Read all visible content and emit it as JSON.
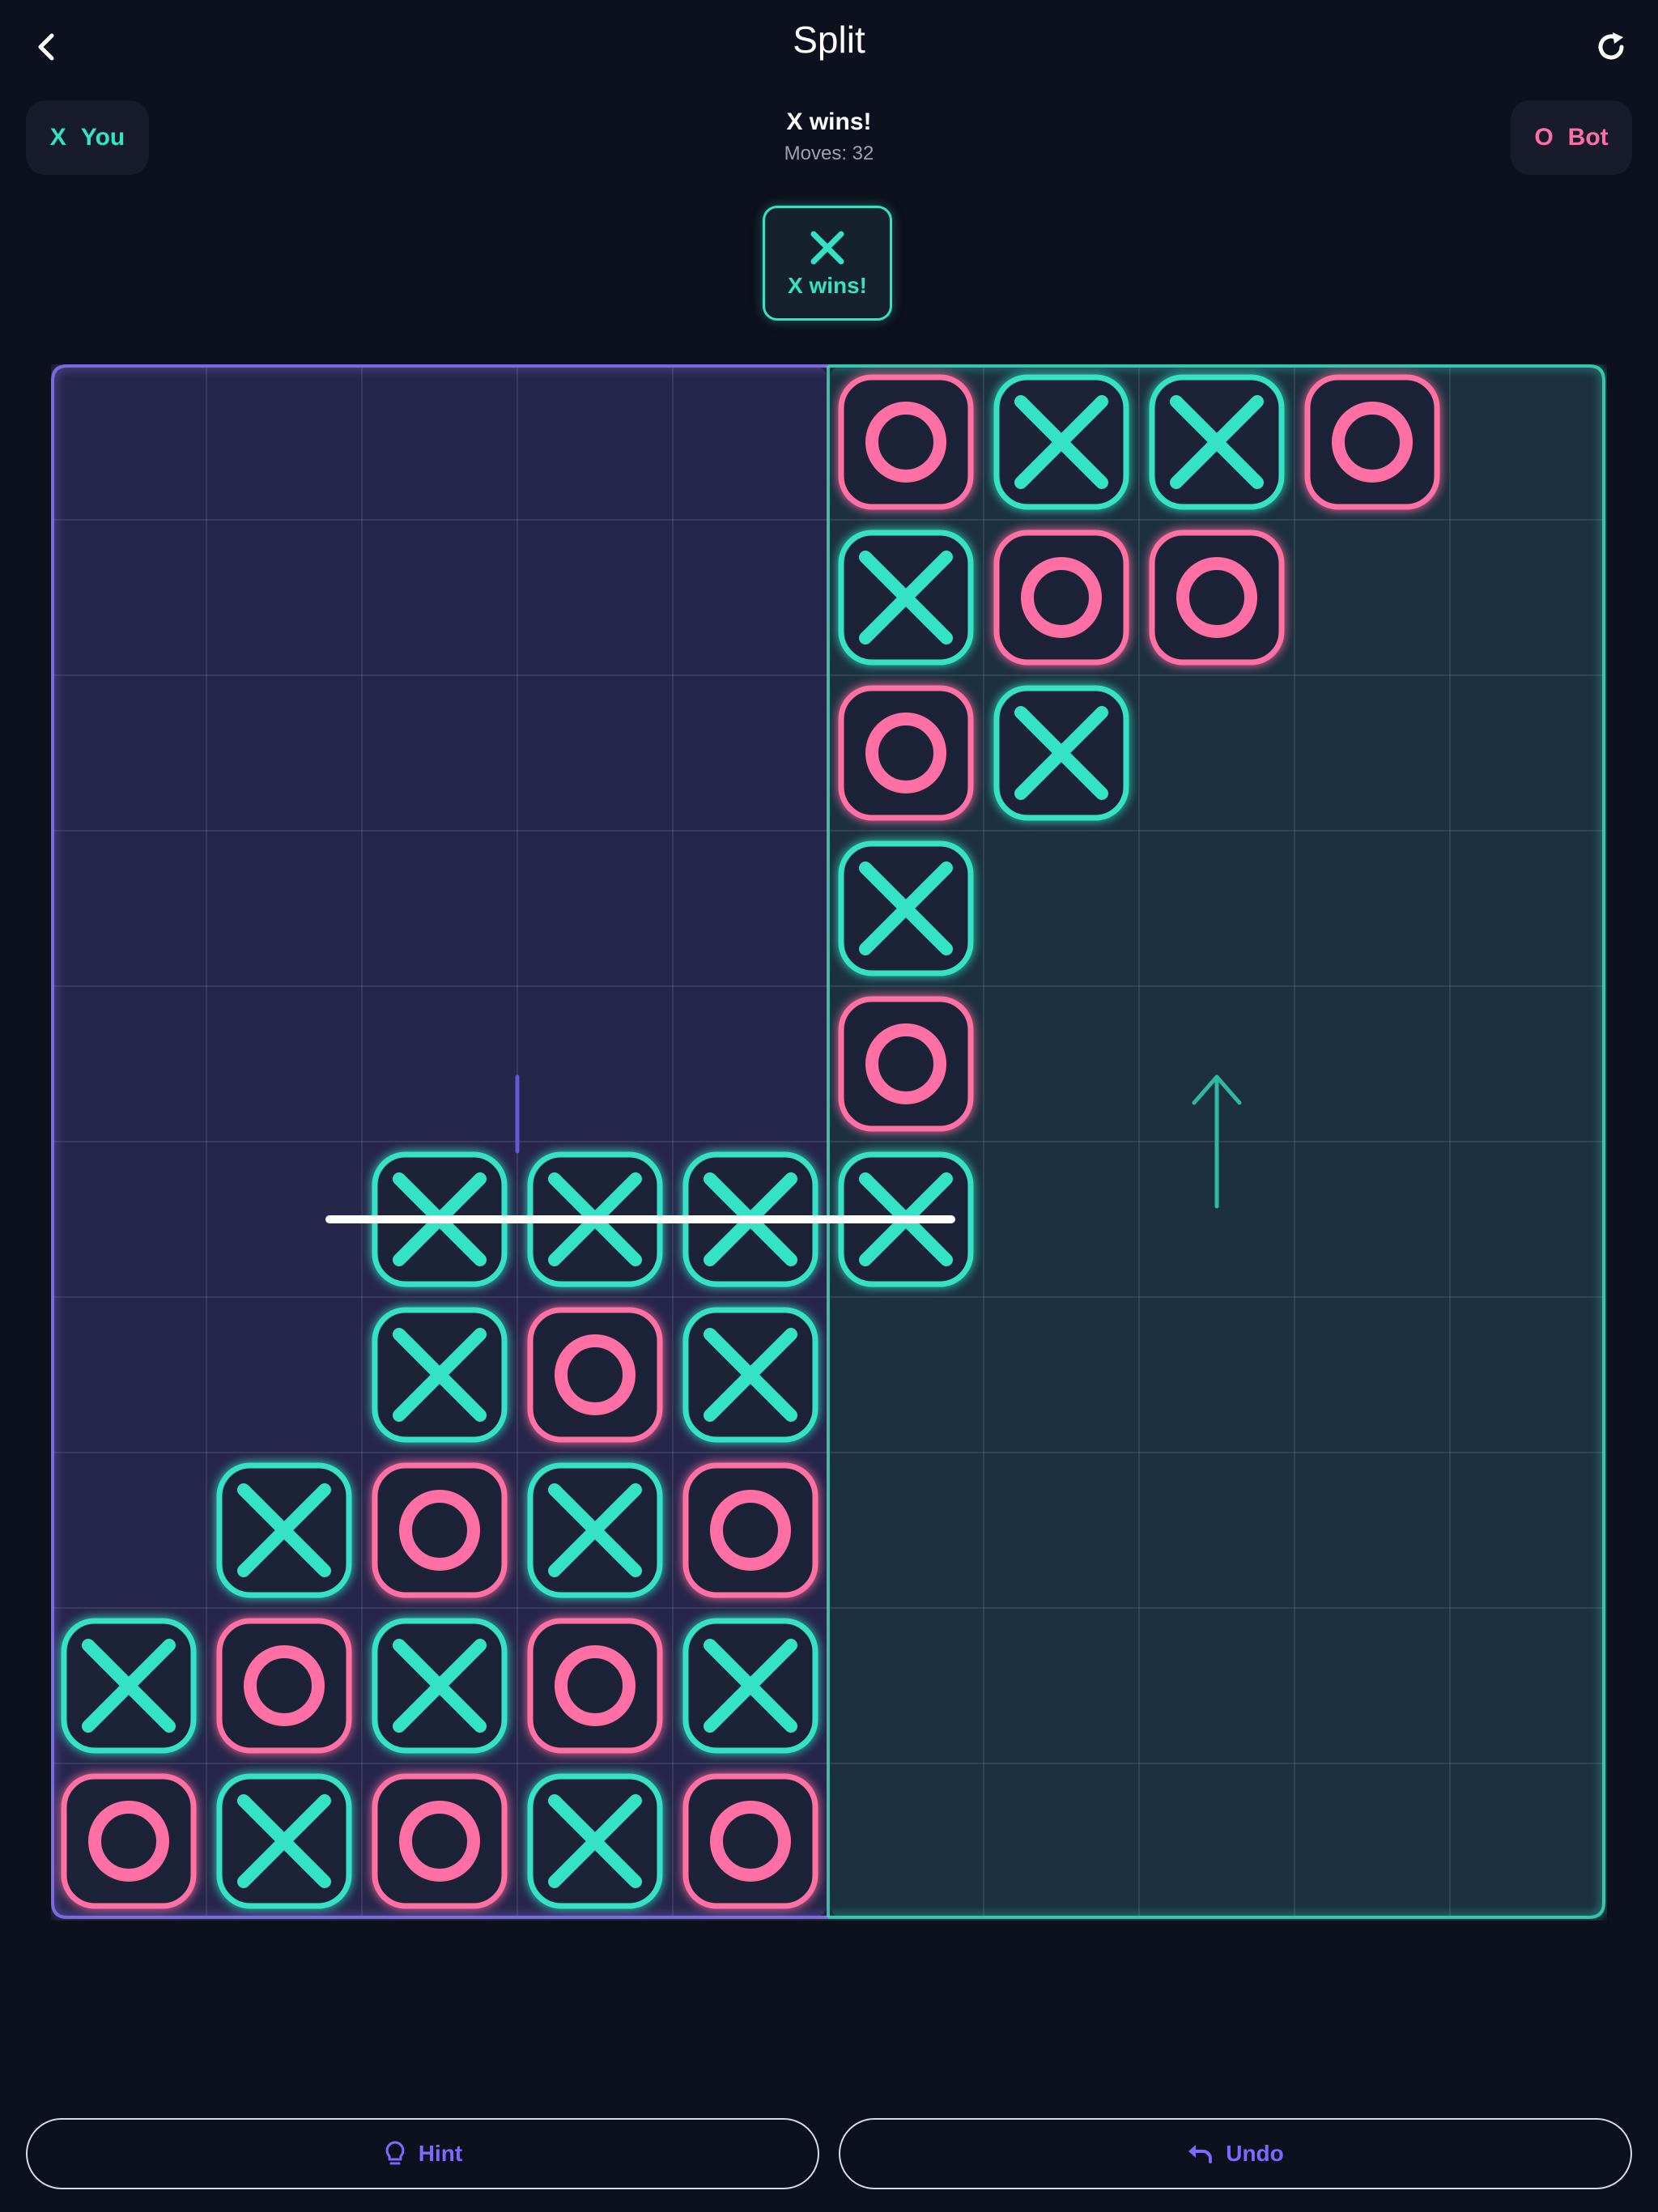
{
  "header": {
    "title": "Split",
    "back_icon": "chevron-left-icon",
    "refresh_icon": "refresh-icon"
  },
  "players": {
    "x": {
      "mark": "X",
      "label": "You",
      "color": "#34e2c6"
    },
    "o": {
      "mark": "O",
      "label": "Bot",
      "color": "#ff6fa3"
    }
  },
  "status": {
    "text": "X wins!",
    "moves": "Moves: 32"
  },
  "winner_badge": {
    "label": "X wins!",
    "icon": "x-mark-icon"
  },
  "board": {
    "size": 10,
    "left_region_color": "#26264a",
    "right_region_color": "#1c3040",
    "left_gravity": "down",
    "right_gravity": "up",
    "grid": [
      [
        "",
        "",
        "",
        "",
        "",
        "O",
        "X",
        "X",
        "O",
        ""
      ],
      [
        "",
        "",
        "",
        "",
        "",
        "X",
        "O",
        "O",
        "",
        ""
      ],
      [
        "",
        "",
        "",
        "",
        "",
        "O",
        "X",
        "",
        "",
        ""
      ],
      [
        "",
        "",
        "",
        "",
        "",
        "X",
        "",
        "",
        "",
        ""
      ],
      [
        "",
        "",
        "",
        "",
        "",
        "O",
        "",
        "",
        "",
        ""
      ],
      [
        "",
        "",
        "X",
        "X",
        "X",
        "X",
        "",
        "",
        "",
        ""
      ],
      [
        "",
        "",
        "X",
        "O",
        "X",
        "",
        "",
        "",
        "",
        ""
      ],
      [
        "",
        "X",
        "O",
        "X",
        "O",
        "",
        "",
        "",
        "",
        ""
      ],
      [
        "X",
        "O",
        "X",
        "O",
        "X",
        "",
        "",
        "",
        "",
        ""
      ],
      [
        "O",
        "X",
        "O",
        "X",
        "O",
        "",
        "",
        "",
        "",
        ""
      ]
    ],
    "winning_line": {
      "row": 5,
      "from_col": 2,
      "to_col": 5
    }
  },
  "actions": {
    "hint_label": "Hint",
    "hint_icon": "lightbulb-icon",
    "undo_label": "Undo",
    "undo_icon": "undo-icon"
  }
}
